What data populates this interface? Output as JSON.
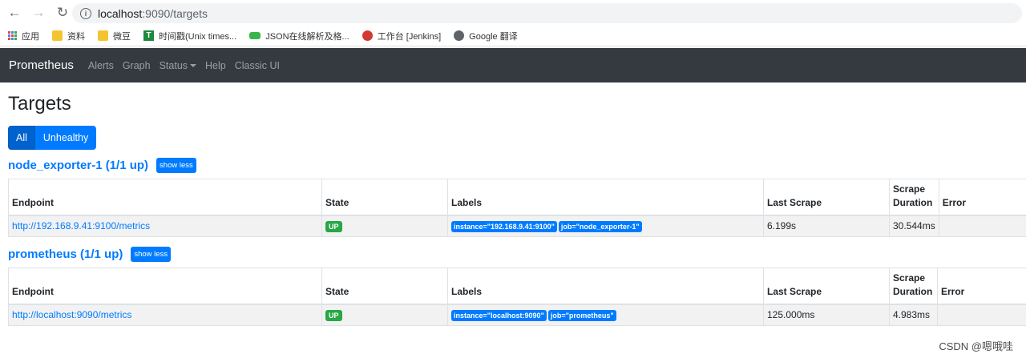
{
  "browser": {
    "url_host": "localhost",
    "url_path": ":9090/targets",
    "bookmarks": [
      {
        "label": "应用",
        "icon": "apps-grid-icon"
      },
      {
        "label": "资料",
        "icon": "folder-icon"
      },
      {
        "label": "微豆",
        "icon": "folder-icon"
      },
      {
        "label": "时间戳(Unix times...",
        "icon": "time-icon"
      },
      {
        "label": "JSON在线解析及格...",
        "icon": "json-icon"
      },
      {
        "label": "工作台 [Jenkins]",
        "icon": "jenkins-icon"
      },
      {
        "label": "Google 翻译",
        "icon": "google-icon"
      }
    ]
  },
  "navbar": {
    "brand": "Prometheus",
    "links": [
      "Alerts",
      "Graph",
      "Status",
      "Help",
      "Classic UI"
    ]
  },
  "page": {
    "title": "Targets",
    "filters": {
      "all": "All",
      "unhealthy": "Unhealthy"
    }
  },
  "table_headers": {
    "endpoint": "Endpoint",
    "state": "State",
    "labels": "Labels",
    "last_scrape": "Last Scrape",
    "scrape_duration_1": "Scrape",
    "scrape_duration_2": "Duration",
    "error": "Error"
  },
  "jobs": [
    {
      "title": "node_exporter-1 (1/1 up)",
      "toggle": "show less",
      "endpoint": "http://192.168.9.41:9100/metrics",
      "state": "UP",
      "label_instance": "instance=\"192.168.9.41:9100\"",
      "label_job": "job=\"node_exporter-1\"",
      "last_scrape": "6.199s",
      "duration": "30.544ms",
      "error": ""
    },
    {
      "title": "prometheus (1/1 up)",
      "toggle": "show less",
      "endpoint": "http://localhost:9090/metrics",
      "state": "UP",
      "label_instance": "instance=\"localhost:9090\"",
      "label_job": "job=\"prometheus\"",
      "last_scrape": "125.000ms",
      "duration": "4.983ms",
      "error": ""
    }
  ],
  "watermark": "CSDN @嗯哦哇"
}
